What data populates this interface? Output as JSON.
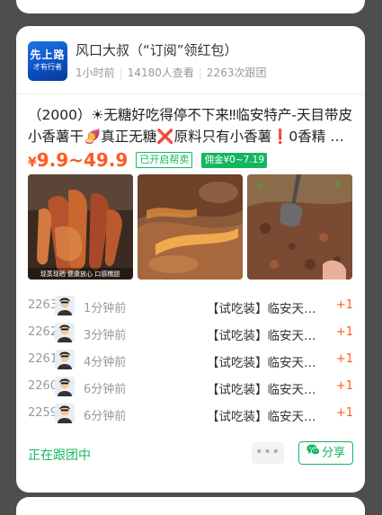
{
  "post": {
    "avatar_text_1": "先上路",
    "avatar_text_2": "才有行者",
    "title": "风口大叔（“订阅”领红包）",
    "time_ago": "1小时前",
    "views": "14180人查看",
    "groups": "2263次跟团"
  },
  "product": {
    "description": "（2000）☀无糖好吃得停不下来‼临安特产-天目带皮小香薯干🍠真正无糖❌原料只有小香薯❗0香精 …",
    "price_symbol": "¥",
    "price_range": "9.9~49.9",
    "badge_help_sell": "已开启帮卖",
    "badge_commission": "佣金¥0~7.19",
    "photo_1_caption": "现蒸现晒 健康放心 口感糯甜"
  },
  "orders": [
    {
      "num": "2263",
      "time": "1分钟前",
      "product": "【试吃装】临安天…",
      "qty": "+1"
    },
    {
      "num": "2262",
      "time": "3分钟前",
      "product": "【试吃装】临安天…",
      "qty": "+1"
    },
    {
      "num": "2261",
      "time": "4分钟前",
      "product": "【试吃装】临安天…",
      "qty": "+1"
    },
    {
      "num": "2260",
      "time": "6分钟前",
      "product": "【试吃装】临安天…",
      "qty": "+1"
    },
    {
      "num": "2259",
      "time": "6分钟前",
      "product": "【试吃装】临安天…",
      "qty": "+1"
    }
  ],
  "footer": {
    "status": "正在跟团中",
    "more_label": "•••",
    "share_label": "分享"
  },
  "colors": {
    "accent_green": "#13b760",
    "price_orange": "#ff5a1f"
  }
}
